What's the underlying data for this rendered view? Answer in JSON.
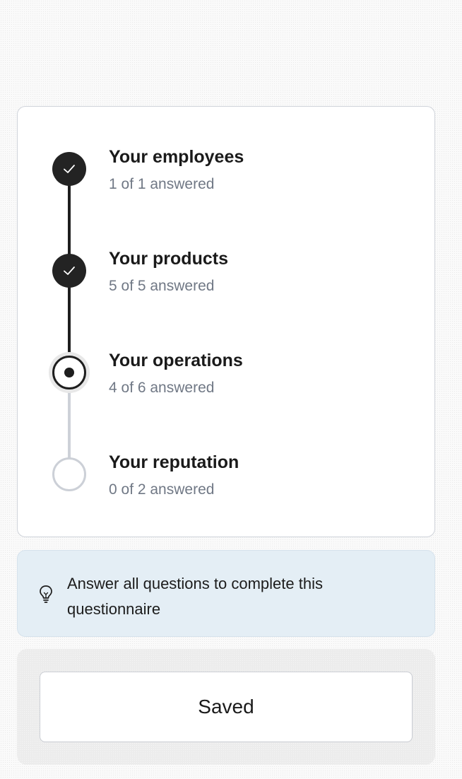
{
  "steps": [
    {
      "title": "Your employees",
      "progress": "1 of 1 answered",
      "status": "completed",
      "answered": 1,
      "total": 1,
      "icon": "check-icon"
    },
    {
      "title": "Your products",
      "progress": "5 of 5 answered",
      "status": "completed",
      "answered": 5,
      "total": 5,
      "icon": "check-icon"
    },
    {
      "title": "Your operations",
      "progress": "4 of 6 answered",
      "status": "current",
      "answered": 4,
      "total": 6,
      "icon": "current-dot-icon"
    },
    {
      "title": "Your reputation",
      "progress": "0 of 2 answered",
      "status": "pending",
      "answered": 0,
      "total": 2,
      "icon": "empty-circle-icon"
    }
  ],
  "hint": {
    "icon": "lightbulb-icon",
    "text": "Answer all questions to complete this questionnaire"
  },
  "footer": {
    "button_label": "Saved"
  },
  "colors": {
    "completed": "#232323",
    "pending": "#ccd0d7",
    "hint_background": "#e4eef5",
    "subtitle": "#707885"
  }
}
